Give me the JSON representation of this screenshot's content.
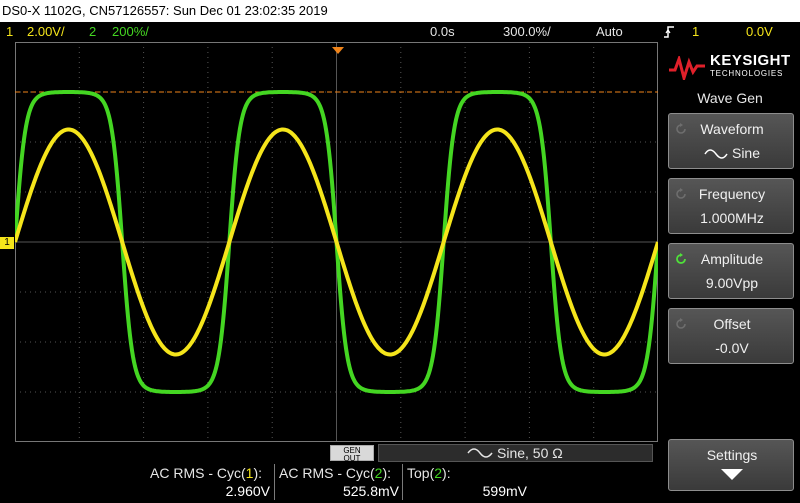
{
  "title_bar": {
    "text": "DS0-X 1102G, CN57126557: Sun Dec 01 23:02:35 2019"
  },
  "status": {
    "ch1_number": "1",
    "ch1_scale": "2.00V/",
    "ch2_number": "2",
    "ch2_scale": "200%/",
    "time_delay": "0.0s",
    "time_scale": "300.0%/",
    "trigger_mode": "Auto",
    "trigger_icon": "trigger-edge-icon",
    "trigger_channel": "1",
    "trigger_level": "0.0V"
  },
  "colors": {
    "ch1": "#f5e51b",
    "ch2": "#44d622",
    "grid": "#555555",
    "trigger_marker": "#f0841a"
  },
  "screen_markers": {
    "ch1_ground": "1",
    "trigger_arrow": "T"
  },
  "sidebar": {
    "brand": "KEYSIGHT",
    "brand_sub": "TECHNOLOGIES",
    "menu_title": "Wave Gen",
    "softkeys": [
      {
        "label": "Waveform",
        "value": "Sine",
        "value_icon": "sine-wave-icon"
      },
      {
        "label": "Frequency",
        "value": "1.000MHz"
      },
      {
        "label": "Amplitude",
        "value": "9.00Vpp"
      },
      {
        "label": "Offset",
        "value": "-0.0V"
      },
      {
        "label": "Settings",
        "value_icon": "arrow-down-icon"
      }
    ]
  },
  "gen_out": {
    "line1": "GEN",
    "line2": "OUT"
  },
  "wave_status": {
    "icon": "sine-wave-icon",
    "text": "Sine, 50 Ω"
  },
  "measurements": [
    {
      "label_prefix": "AC RMS - Cyc(",
      "channel": "1",
      "label_suffix": "):",
      "value": "2.960V"
    },
    {
      "label_prefix": "AC RMS - Cyc(",
      "channel": "2",
      "label_suffix": "):",
      "value": "525.8mV"
    },
    {
      "label_prefix": "Top(",
      "channel": "2",
      "label_suffix": "):",
      "value": "599mV"
    }
  ],
  "traces": {
    "ch1": {
      "shape": "sine",
      "cycles_on_screen": 3,
      "amplitude_divisions": 2.25
    },
    "ch2": {
      "shape": "clipped-sine",
      "cycles_on_screen": 3,
      "amplitude_divisions": 3.0
    }
  }
}
